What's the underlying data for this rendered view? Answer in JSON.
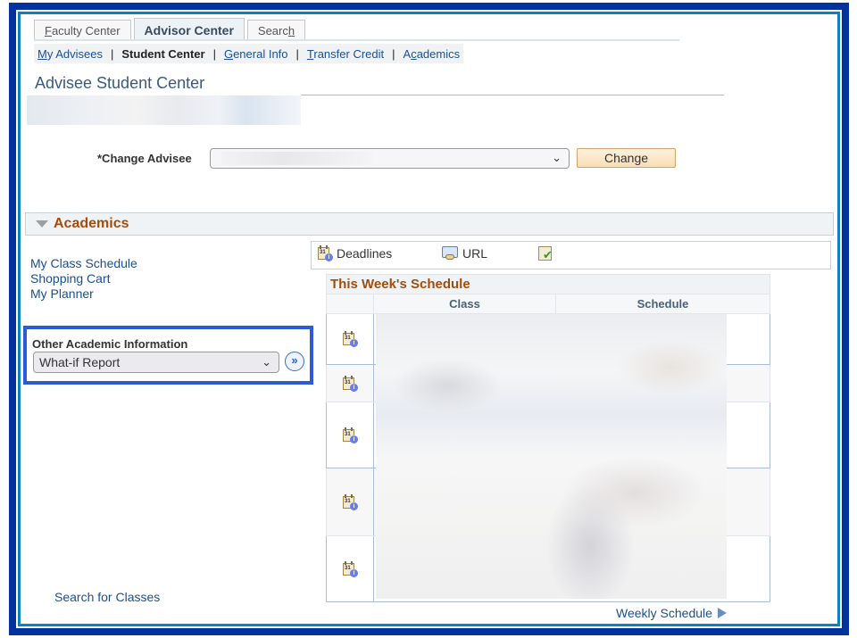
{
  "tabs": [
    {
      "label": "Faculty Center",
      "active": false
    },
    {
      "label": "Advisor Center",
      "active": true
    },
    {
      "label": "Search",
      "active": false
    }
  ],
  "subnav": {
    "items": [
      {
        "label": "My Advisees",
        "current": false
      },
      {
        "label": "Student Center",
        "current": true
      },
      {
        "label": "General Info",
        "current": false
      },
      {
        "label": "Transfer Credit",
        "current": false
      },
      {
        "label": "Academics",
        "current": false
      }
    ],
    "separator": "|"
  },
  "page": {
    "title": "Advisee Student Center"
  },
  "change_advisee": {
    "label": "*Change Advisee",
    "button_label": "Change"
  },
  "academics": {
    "section_title": "Academics",
    "links": [
      "My Class Schedule",
      "Shopping Cart",
      "My Planner"
    ],
    "other_info_label": "Other Academic Information",
    "other_info_selected": "What-if Report",
    "go_icon": "double-chevron-right-icon",
    "search_classes_label": "Search for Classes"
  },
  "toolbar": {
    "deadlines_label": "Deadlines",
    "url_label": "URL"
  },
  "schedule": {
    "title": "This Week's Schedule",
    "columns": [
      "",
      "Class",
      "Schedule"
    ],
    "row_count": 5,
    "weekly_link": "Weekly Schedule"
  },
  "colors": {
    "frame_outer": "#0033a0",
    "frame_inner": "#0a82bf",
    "section_title": "#a34d0d",
    "link": "#1a4f96",
    "highlight_box": "#2a5bdb"
  }
}
